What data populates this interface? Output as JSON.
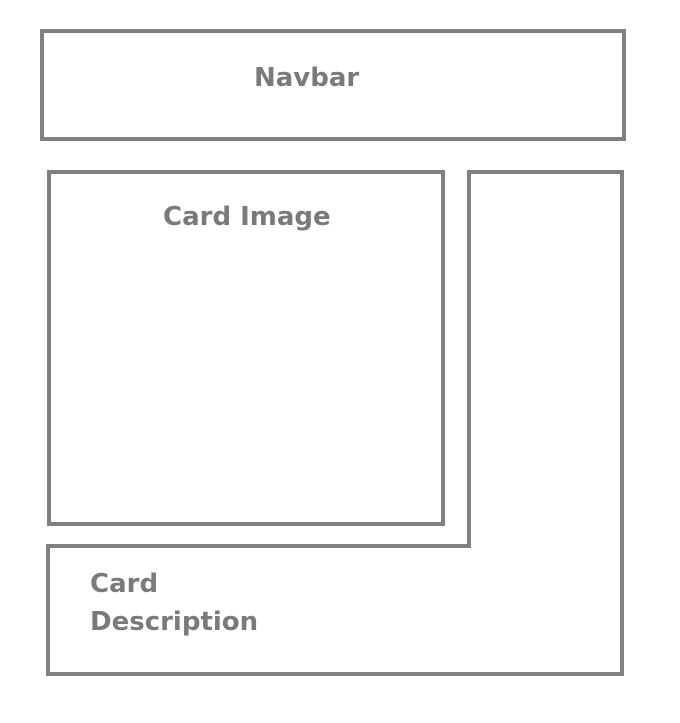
{
  "navbar": {
    "label": "Navbar"
  },
  "card": {
    "image_label": "Card Image",
    "description_label_line1": "Card",
    "description_label_line2": "Description"
  },
  "colors": {
    "stroke": "#808080",
    "text": "#7a7a7a",
    "background": "#ffffff"
  }
}
